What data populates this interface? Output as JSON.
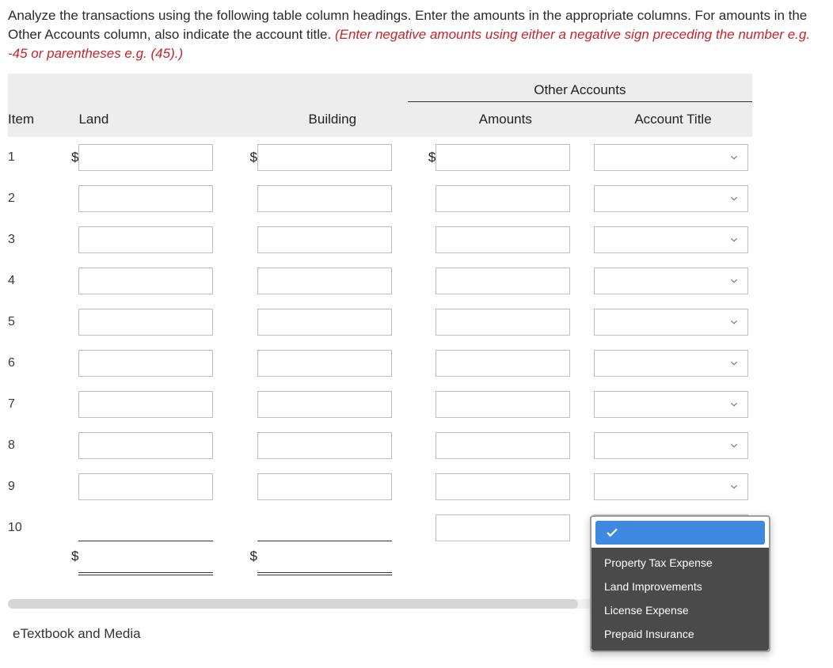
{
  "instructions": {
    "part1": "Analyze the transactions using the following table column headings. Enter the amounts in the appropriate columns. For amounts in the Other Accounts column, also indicate the account title. ",
    "part2_red": "(Enter negative amounts using either a negative sign preceding the number e.g. -45 or parentheses e.g. (45).)"
  },
  "headers": {
    "item": "Item",
    "land": "Land",
    "building": "Building",
    "other_accounts_group": "Other Accounts",
    "amounts": "Amounts",
    "account_title": "Account Title"
  },
  "dollar": "$",
  "rows": [
    {
      "n": "1",
      "land": "",
      "building": "",
      "amount": "",
      "title": ""
    },
    {
      "n": "2",
      "land": "",
      "building": "",
      "amount": "",
      "title": ""
    },
    {
      "n": "3",
      "land": "",
      "building": "",
      "amount": "",
      "title": ""
    },
    {
      "n": "4",
      "land": "",
      "building": "",
      "amount": "",
      "title": ""
    },
    {
      "n": "5",
      "land": "",
      "building": "",
      "amount": "",
      "title": ""
    },
    {
      "n": "6",
      "land": "",
      "building": "",
      "amount": "",
      "title": ""
    },
    {
      "n": "7",
      "land": "",
      "building": "",
      "amount": "",
      "title": ""
    },
    {
      "n": "8",
      "land": "",
      "building": "",
      "amount": "",
      "title": ""
    },
    {
      "n": "9",
      "land": "",
      "building": "",
      "amount": "",
      "title": ""
    },
    {
      "n": "10",
      "land": "",
      "building": "",
      "amount": "",
      "title": ""
    }
  ],
  "totals": {
    "land": "",
    "building": ""
  },
  "dropdown": {
    "selected": "",
    "options": [
      "Property Tax Expense",
      "Land Improvements",
      "License Expense",
      "Prepaid Insurance"
    ]
  },
  "footer_link": "eTextbook and Media"
}
